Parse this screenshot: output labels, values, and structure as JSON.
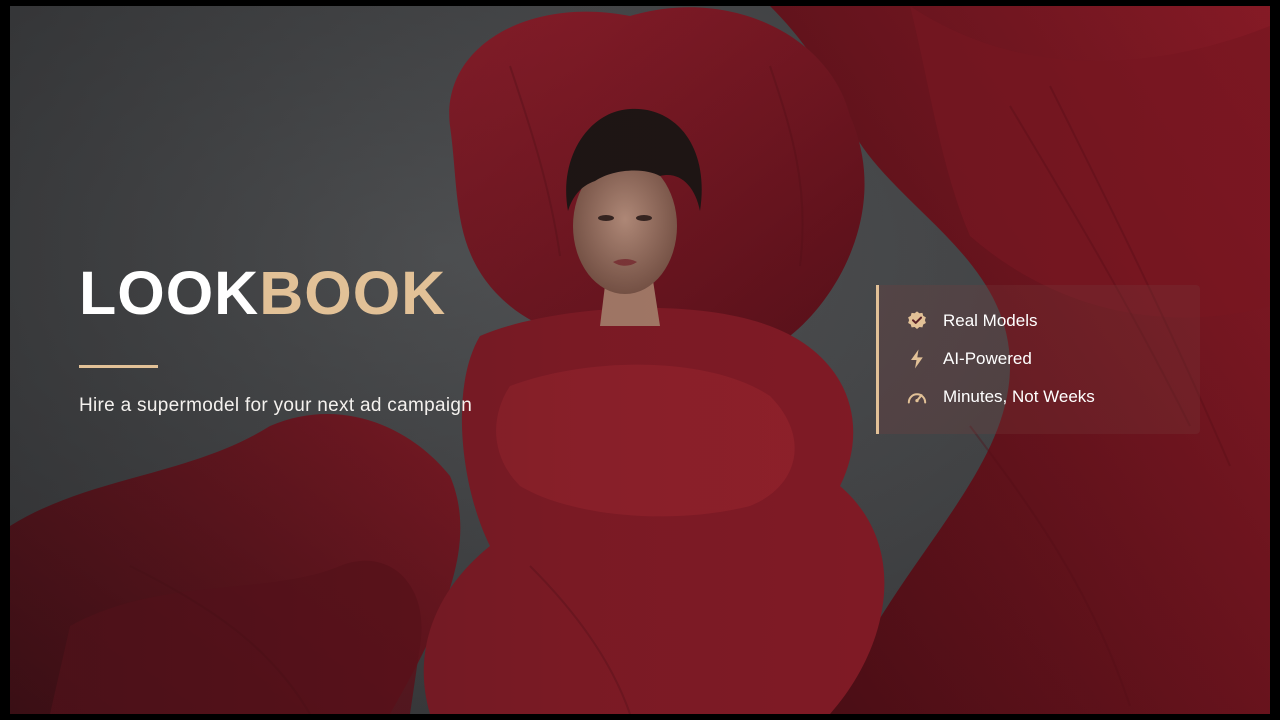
{
  "brand": {
    "name_part1": "LOOK",
    "name_part2": "BOOK"
  },
  "tagline": "Hire a supermodel for your next ad campaign",
  "features": [
    {
      "label": "Real Models",
      "icon": "verified-badge-icon"
    },
    {
      "label": "AI-Powered",
      "icon": "lightning-bolt-icon"
    },
    {
      "label": "Minutes, Not Weeks",
      "icon": "speedometer-icon"
    }
  ],
  "colors": {
    "accent": "#e2c197",
    "text": "#ffffff",
    "petal": "#7a1420",
    "backdrop": "#4b4d4f"
  }
}
